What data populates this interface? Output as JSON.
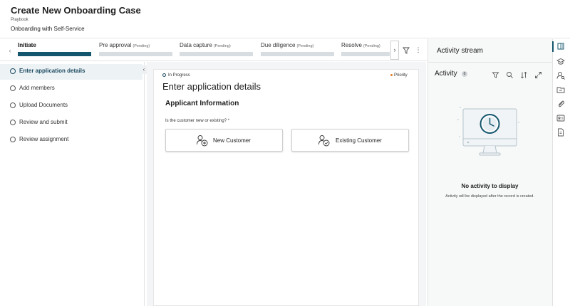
{
  "header": {
    "title": "Create New Onboarding Case",
    "playbook_label": "Playbook",
    "playbook_name": "Onboarding with Self-Service"
  },
  "stages": [
    {
      "name": "Initiate",
      "status": "",
      "active": true
    },
    {
      "name": "Pre approval",
      "status": "(Pending)",
      "active": false
    },
    {
      "name": "Data capture",
      "status": "(Pending)",
      "active": false
    },
    {
      "name": "Due diligence",
      "status": "(Pending)",
      "active": false
    },
    {
      "name": "Resolve",
      "status": "(Pending)",
      "active": false
    }
  ],
  "steps": [
    {
      "label": "Enter application details",
      "active": true
    },
    {
      "label": "Add members",
      "active": false
    },
    {
      "label": "Upload Documents",
      "active": false
    },
    {
      "label": "Review and submit",
      "active": false
    },
    {
      "label": "Review assignment",
      "active": false
    }
  ],
  "card": {
    "status": "In Progress",
    "priority": "Priority",
    "title": "Enter application details",
    "section": "Applicant Information",
    "question": "Is the customer new or existing? *",
    "choices": [
      "New Customer",
      "Existing Customer"
    ]
  },
  "activity": {
    "stream_title": "Activity stream",
    "heading": "Activity",
    "count": "0",
    "empty_title": "No activity to display",
    "empty_subtitle": "Activity will be displayed after the record is created."
  },
  "icons": {
    "stage_prev": "‹",
    "stage_next": "›",
    "more": "⋮",
    "collapse": "‹"
  },
  "colors": {
    "accent": "#14566d",
    "priority": "#e67e22"
  }
}
